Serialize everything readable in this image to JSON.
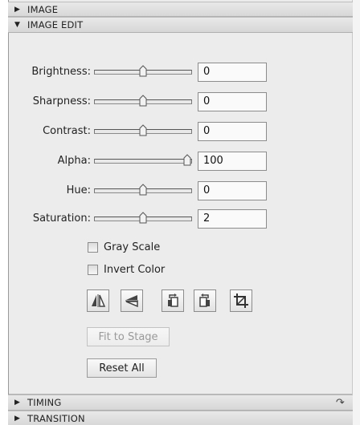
{
  "sections": {
    "image": {
      "label": "IMAGE",
      "expanded": false
    },
    "image_edit": {
      "label": "IMAGE EDIT",
      "expanded": true
    },
    "timing": {
      "label": "TIMING",
      "expanded": false
    },
    "transition": {
      "label": "TRANSITION",
      "expanded": false
    }
  },
  "controls": {
    "brightness": {
      "label": "Brightness:",
      "value": "0",
      "level": 0.5
    },
    "sharpness": {
      "label": "Sharpness:",
      "value": "0",
      "level": 0.5
    },
    "contrast": {
      "label": "Contrast:",
      "value": "0",
      "level": 0.5
    },
    "alpha": {
      "label": "Alpha:",
      "value": "100",
      "level": 1.0
    },
    "hue": {
      "label": "Hue:",
      "value": "0",
      "level": 0.5
    },
    "saturation": {
      "label": "Saturation:",
      "value": "2",
      "level": 0.5
    }
  },
  "checkboxes": {
    "gray_scale": {
      "label": "Gray Scale",
      "checked": false
    },
    "invert_color": {
      "label": "Invert Color",
      "checked": false
    }
  },
  "transform_icons": [
    "flip-horizontal-icon",
    "flip-vertical-icon",
    "rotate-left-icon",
    "rotate-right-icon",
    "crop-icon"
  ],
  "buttons": {
    "fit_to_stage": {
      "label": "Fit to Stage",
      "enabled": false
    },
    "reset_all": {
      "label": "Reset All",
      "enabled": true
    }
  },
  "timing_icon": "undo-arrow-icon"
}
